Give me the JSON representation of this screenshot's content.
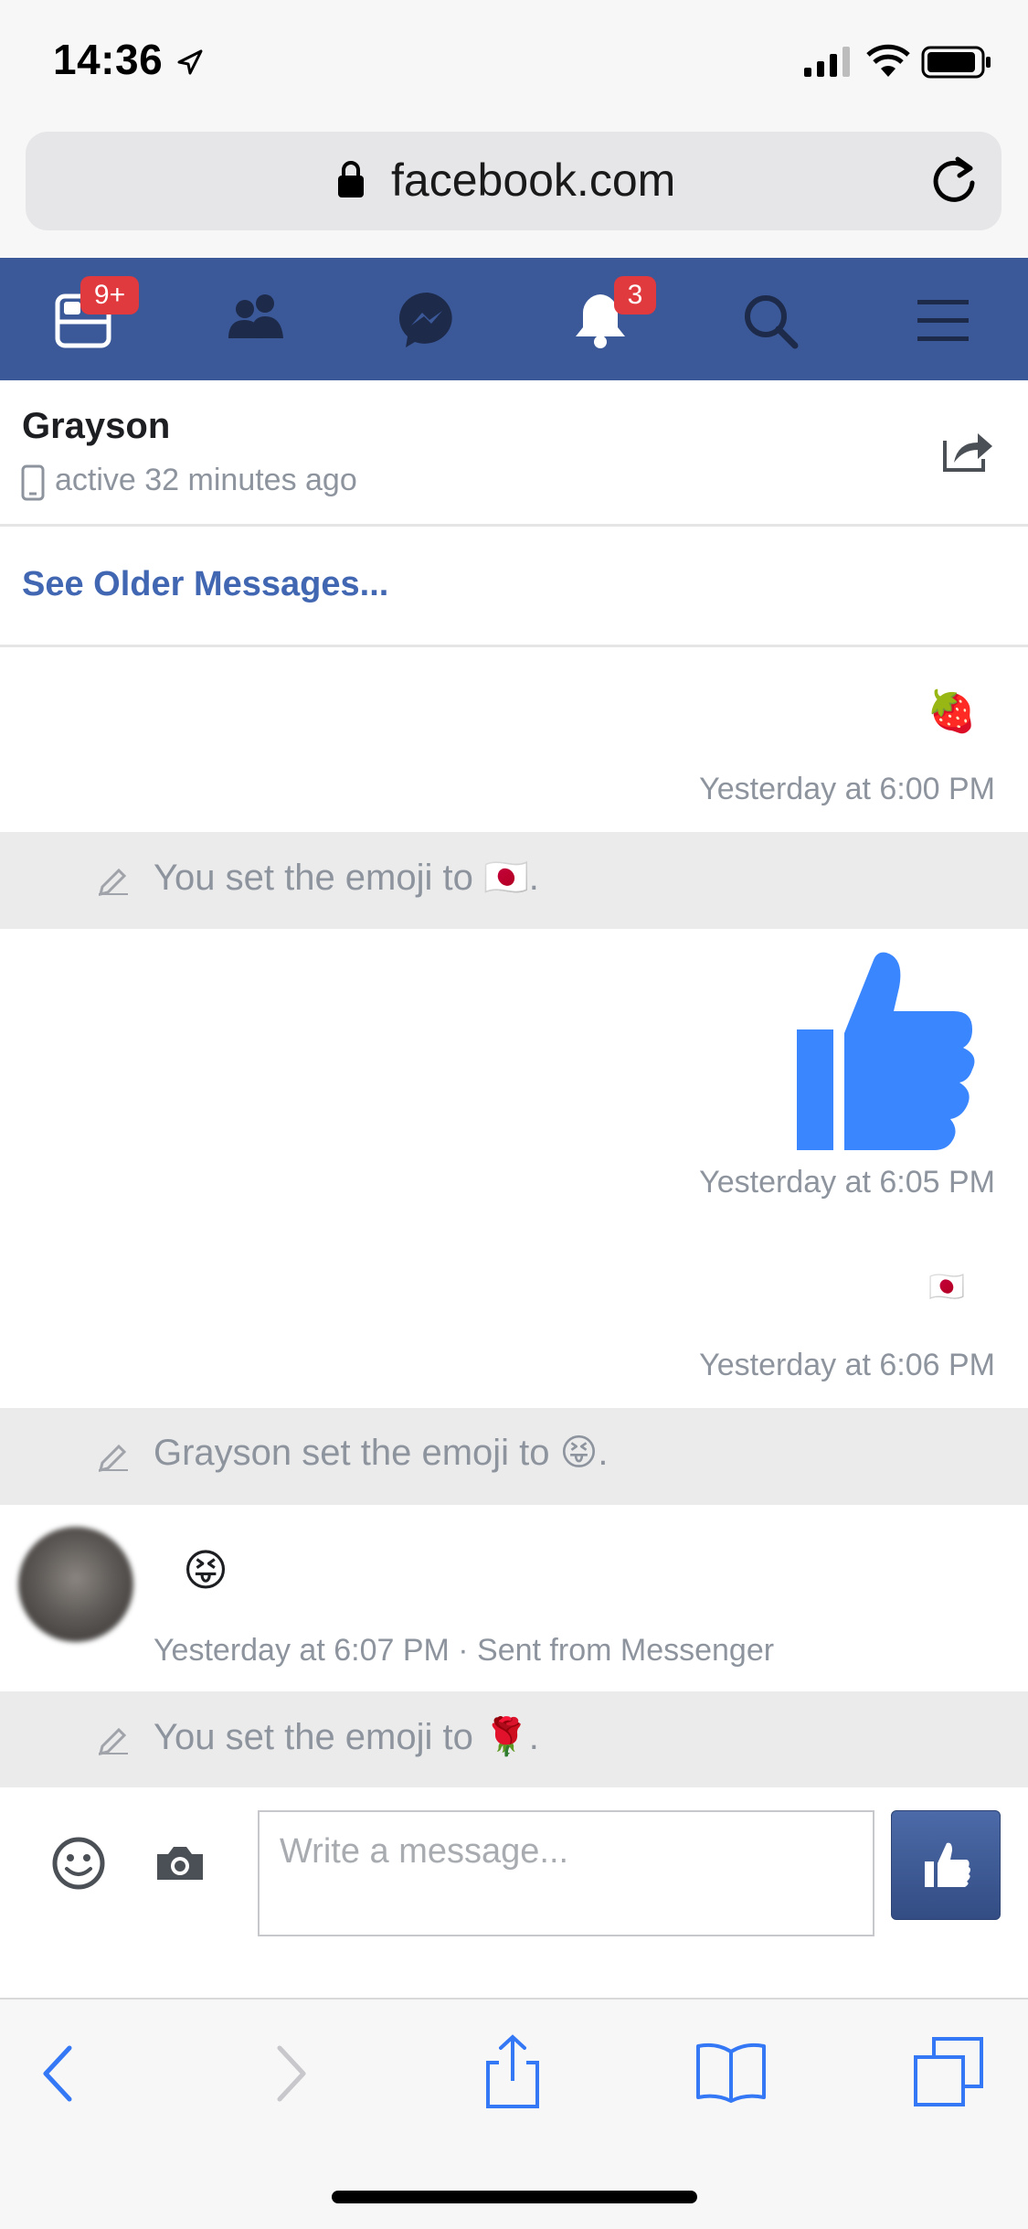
{
  "status_bar": {
    "time": "14:36"
  },
  "browser": {
    "url": "facebook.com"
  },
  "nav": {
    "feed_badge": "9+",
    "notifications_badge": "3"
  },
  "conversation": {
    "contact_name": "Grayson",
    "presence": "active 32 minutes ago",
    "see_older": "See Older Messages..."
  },
  "messages": [
    {
      "type": "emoji",
      "content": "🍓",
      "timestamp": "Yesterday at 6:00 PM"
    },
    {
      "type": "system",
      "text": "You set the emoji to 🇯🇵."
    },
    {
      "type": "like",
      "timestamp": "Yesterday at 6:05 PM"
    },
    {
      "type": "emoji",
      "content": "🇯🇵",
      "timestamp": "Yesterday at 6:06 PM"
    },
    {
      "type": "system",
      "text": "Grayson set the emoji to 😝."
    },
    {
      "type": "incoming",
      "content": "😝",
      "timestamp": "Yesterday at 6:07 PM · Sent from Messenger"
    },
    {
      "type": "system",
      "text": "You set the emoji to 🌹."
    }
  ],
  "composer": {
    "placeholder": "Write a message..."
  },
  "colors": {
    "brand": "#3b5998",
    "badge": "#e0393e",
    "link": "#4267b2",
    "like": "#3a86ff"
  }
}
